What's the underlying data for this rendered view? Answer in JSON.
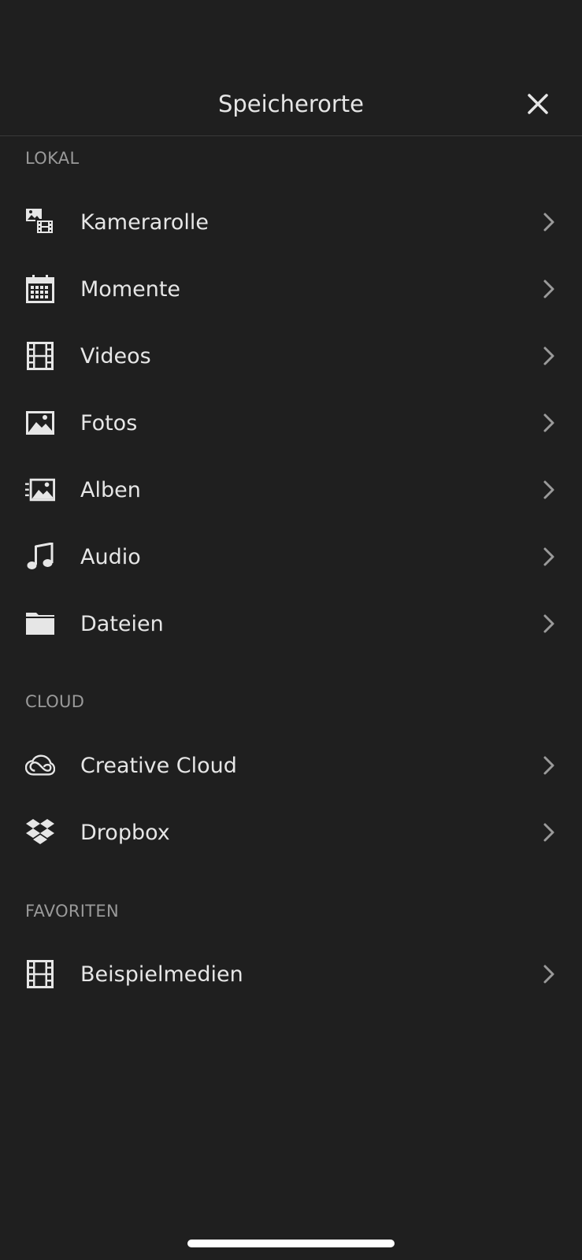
{
  "header": {
    "title": "Speicherorte",
    "close_icon": "close-icon"
  },
  "sections": {
    "lokal": {
      "label": "LOKAL",
      "items": [
        {
          "label": "Kamerarolle",
          "icon": "camera-roll-icon"
        },
        {
          "label": "Momente",
          "icon": "calendar-icon"
        },
        {
          "label": "Videos",
          "icon": "film-icon"
        },
        {
          "label": "Fotos",
          "icon": "photo-icon"
        },
        {
          "label": "Alben",
          "icon": "album-icon"
        },
        {
          "label": "Audio",
          "icon": "music-note-icon"
        },
        {
          "label": "Dateien",
          "icon": "folder-icon"
        }
      ]
    },
    "cloud": {
      "label": "CLOUD",
      "items": [
        {
          "label": "Creative Cloud",
          "icon": "creative-cloud-icon"
        },
        {
          "label": "Dropbox",
          "icon": "dropbox-icon"
        }
      ]
    },
    "favoriten": {
      "label": "FAVORITEN",
      "items": [
        {
          "label": "Beispielmedien",
          "icon": "film-icon"
        }
      ]
    }
  },
  "colors": {
    "background": "#1f1f1f",
    "text": "#e6e6e6",
    "section_label": "#9a9a9a",
    "divider": "#3a3a3a",
    "chevron": "#9a9a9a"
  }
}
